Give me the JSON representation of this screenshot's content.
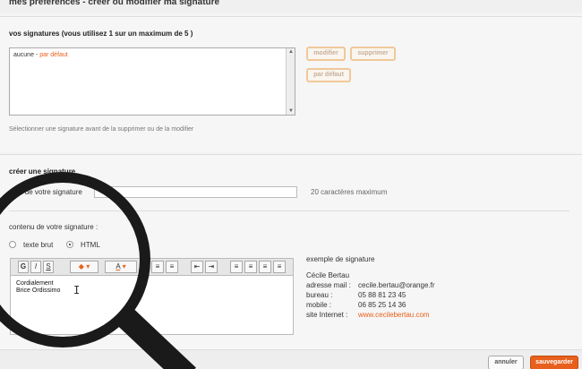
{
  "header": {
    "title": "mes préférences - créer ou modifier ma signature"
  },
  "signatures_section": {
    "title": "vos signatures (vous utilisez 1 sur un maximum de 5 )",
    "list": [
      {
        "name": "aucune",
        "separator": "-",
        "tag": "par défaut"
      }
    ],
    "buttons": {
      "modifier": "modifier",
      "supprimer": "supprimer",
      "par_defaut": "par défaut"
    },
    "hint": "Sélectionner une signature avant de la supprimer ou de la modifier"
  },
  "create_section": {
    "title": "créer une signature",
    "name_label": "nom de votre signature",
    "name_value": "",
    "max_chars": "20 caractères maximum",
    "content_label": "contenu de votre signature :",
    "format": {
      "text_option": "texte brut",
      "html_option": "HTML",
      "selected": "HTML"
    },
    "toolbar": {
      "g": "G",
      "i": "I",
      "s": "S",
      "text_color": "A"
    },
    "editor_lines": [
      "Cordialement",
      "Brice Ordissimo"
    ],
    "example": {
      "title": "exemple de signature",
      "name": "Cécile Bertau",
      "rows": [
        {
          "label": "adresse mail :",
          "value": "cecile.bertau@orange.fr"
        },
        {
          "label": "bureau :",
          "value": "05 88 81 23 45"
        },
        {
          "label": "mobile :",
          "value": "06 85 25 14 36"
        },
        {
          "label": "site Internet :",
          "value": "www.cecilebertau.com"
        }
      ]
    }
  },
  "footer": {
    "cancel": "annuler",
    "save": "sauvegarder"
  },
  "colors": {
    "accent": "#e8601c",
    "button_border": "#f0c89a",
    "background": "#f6f6f6"
  }
}
